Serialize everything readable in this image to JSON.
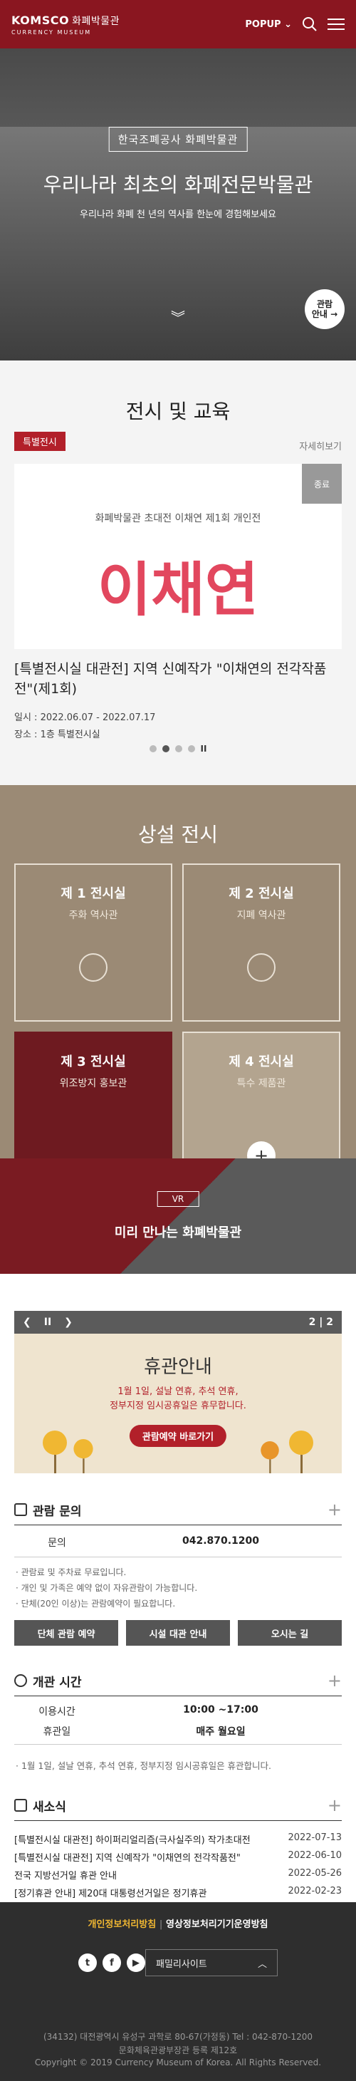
{
  "header": {
    "logo_main": "KOMSCO",
    "logo_kor": "화폐박물관",
    "logo_sub": "CURRENCY MUSEUM",
    "popup_label": "POPUP"
  },
  "hero": {
    "badge": "한국조폐공사 화폐박물관",
    "title": "우리나라 최초의 화폐전문박물관",
    "subtitle": "우리나라 화폐 천 년의 역사를 한눈에 경험해보세요",
    "visit_label_1": "관람",
    "visit_label_2": "안내"
  },
  "exhibition": {
    "heading": "전시 및 교육",
    "tag": "특별전시",
    "more": "자세히보기",
    "end_badge": "종료",
    "card_caption": "화폐박물관 초대전   이채연 제1회 개인전",
    "card_big": "이채연",
    "title": "[특별전시실 대관전] 지역 신예작가 \"이채연의 전각작품전\"(제1회)",
    "date": "일시 : 2022.06.07 - 2022.07.17",
    "place": "장소 : 1층 특별전시실"
  },
  "permanent": {
    "heading": "상설 전시",
    "halls": [
      {
        "name": "제 1 전시실",
        "desc": "주화 역사관"
      },
      {
        "name": "제 2 전시실",
        "desc": "지폐 역사관"
      },
      {
        "name": "제 3 전시실",
        "desc": "위조방지 홍보관"
      },
      {
        "name": "제 4 전시실",
        "desc": "특수 제품관"
      }
    ]
  },
  "vr": {
    "badge": "VR",
    "title": "미리 만나는 화폐박물관"
  },
  "notice_slider": {
    "page_current": "2",
    "page_total": "2",
    "title": "휴관안내",
    "body_1": "1월 1일, 설날 연휴, 추석 연휴,",
    "body_2": "정부지정 임시공휴일은 휴무합니다.",
    "button": "관람예약 바로가기"
  },
  "inquiry": {
    "heading": "관람 문의",
    "key": "문의",
    "value": "042.870.1200",
    "notes": [
      "· 관람료 및 주차료 무료입니다.",
      "· 개인 및 가족은 예약 없이 자유관람이 가능합니다.",
      "· 단체(20인 이상)는 관람예약이 필요합니다."
    ],
    "buttons": [
      "단체 관람 예약",
      "시설 대관 안내",
      "오시는 길"
    ]
  },
  "hours": {
    "heading": "개관 시간",
    "rows": [
      {
        "k": "이용시간",
        "v": "10:00 ~17:00"
      },
      {
        "k": "휴관일",
        "v": "매주 월요일"
      }
    ],
    "note": "· 1월 1일, 설날 연휴, 추석 연휴, 정부지정 임시공휴일은 휴관합니다."
  },
  "news": {
    "heading": "새소식",
    "items": [
      {
        "title": "[특별전시실 대관전] 하이퍼리얼리즘(극사실주의) 작가초대전",
        "date": "2022-07-13"
      },
      {
        "title": "[특별전시실 대관전] 지역 신예작가 \"이채연의 전각작품전\"",
        "date": "2022-06-10"
      },
      {
        "title": "전국 지방선거일 휴관 안내",
        "date": "2022-05-26"
      },
      {
        "title": "[정기휴관 안내] 제20대 대통령선거일은 정기휴관",
        "date": "2022-02-23"
      }
    ]
  },
  "footer": {
    "privacy": "개인정보처리방침",
    "cctv": "영상정보처리기기운영방침",
    "family": "패밀리사이트",
    "address": "(34132) 대전광역시 유성구 과학로 80-67(가정동)   Tel : 042-870-1200",
    "registration": "문화체육관광부장관 등록 제12호",
    "copyright": "Copyright © 2019 Currency Museum of Korea. All Rights Reserved."
  }
}
